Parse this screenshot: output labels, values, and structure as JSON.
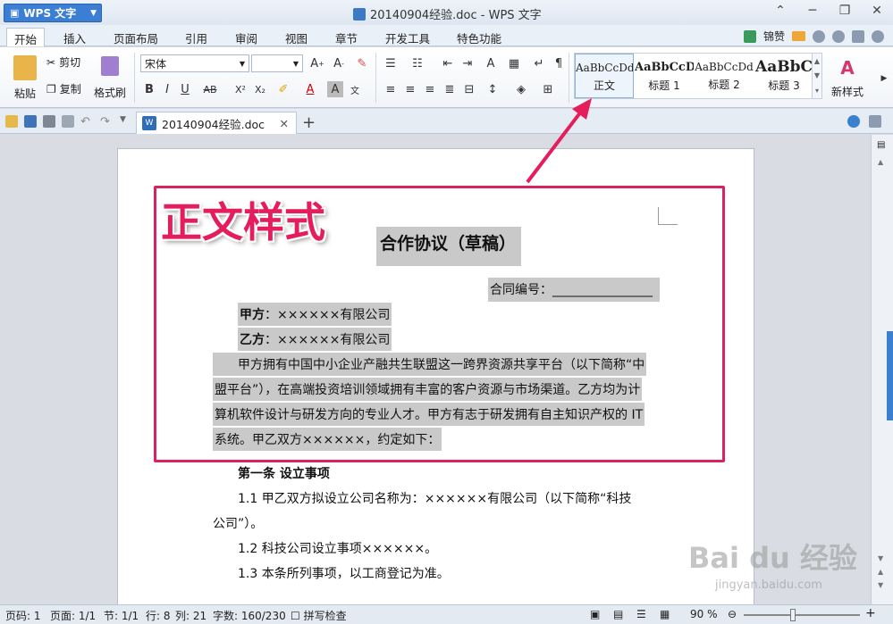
{
  "app": {
    "button_label": "WPS 文字",
    "window_title": "20140904经验.doc - WPS 文字"
  },
  "menu": {
    "tabs": [
      "开始",
      "插入",
      "页面布局",
      "引用",
      "审阅",
      "视图",
      "章节",
      "开发工具",
      "特色功能"
    ],
    "right_label": "锦赞"
  },
  "ribbon": {
    "paste": "粘贴",
    "cut": "剪切",
    "copy": "复制",
    "format_painter": "格式刷",
    "font_name": "宋体",
    "font_size": "",
    "styles": [
      {
        "sample": "AaBbCcDd",
        "label": "正文"
      },
      {
        "sample": "AaBbCcDd",
        "label": "标题 1"
      },
      {
        "sample": "AaBbCcDd",
        "label": "标题 2"
      },
      {
        "sample": "AaBbC",
        "label": "标题 3"
      }
    ],
    "new_style": "新样式"
  },
  "doc_tab": {
    "name": "20140904经验.doc"
  },
  "document": {
    "title": "合作协议（草稿）",
    "contract_no": "合同编号：________________",
    "party_a_label": "甲方",
    "party_a_value": "：××××××有限公司",
    "party_b_label": "乙方",
    "party_b_value": "：××××××有限公司",
    "para1": [
      "甲方拥有中国中小企业产融共生联盟这一跨界资源共享平台（以下简称“中",
      "盟平台”），在高端投资培训领域拥有丰富的客户资源与市场渠道。乙方均为计",
      "算机软件设计与研发方向的专业人才。甲方有志于研发拥有自主知识产权的 IT",
      "系统。甲乙双方××××××，约定如下："
    ],
    "article1": "第一条  设立事项",
    "item11": [
      "1.1 甲乙双方拟设立公司名称为：××××××有限公司（以下简称“科技",
      "公司”）。"
    ],
    "item12": "1.2 科技公司设立事项××××××。",
    "item13": "1.3 本条所列事项，以工商登记为准。"
  },
  "annotation": {
    "label": "正文样式"
  },
  "watermark": {
    "brand": "Bai du 经验",
    "url": "jingyan.baidu.com"
  },
  "status": {
    "page_code": "页码: 1",
    "page": "页面: 1/1",
    "section": "节: 1/1",
    "row": "行: 8",
    "col": "列: 21",
    "words": "字数: 160/230",
    "spell": "拼写检查",
    "zoom": "90 %"
  }
}
